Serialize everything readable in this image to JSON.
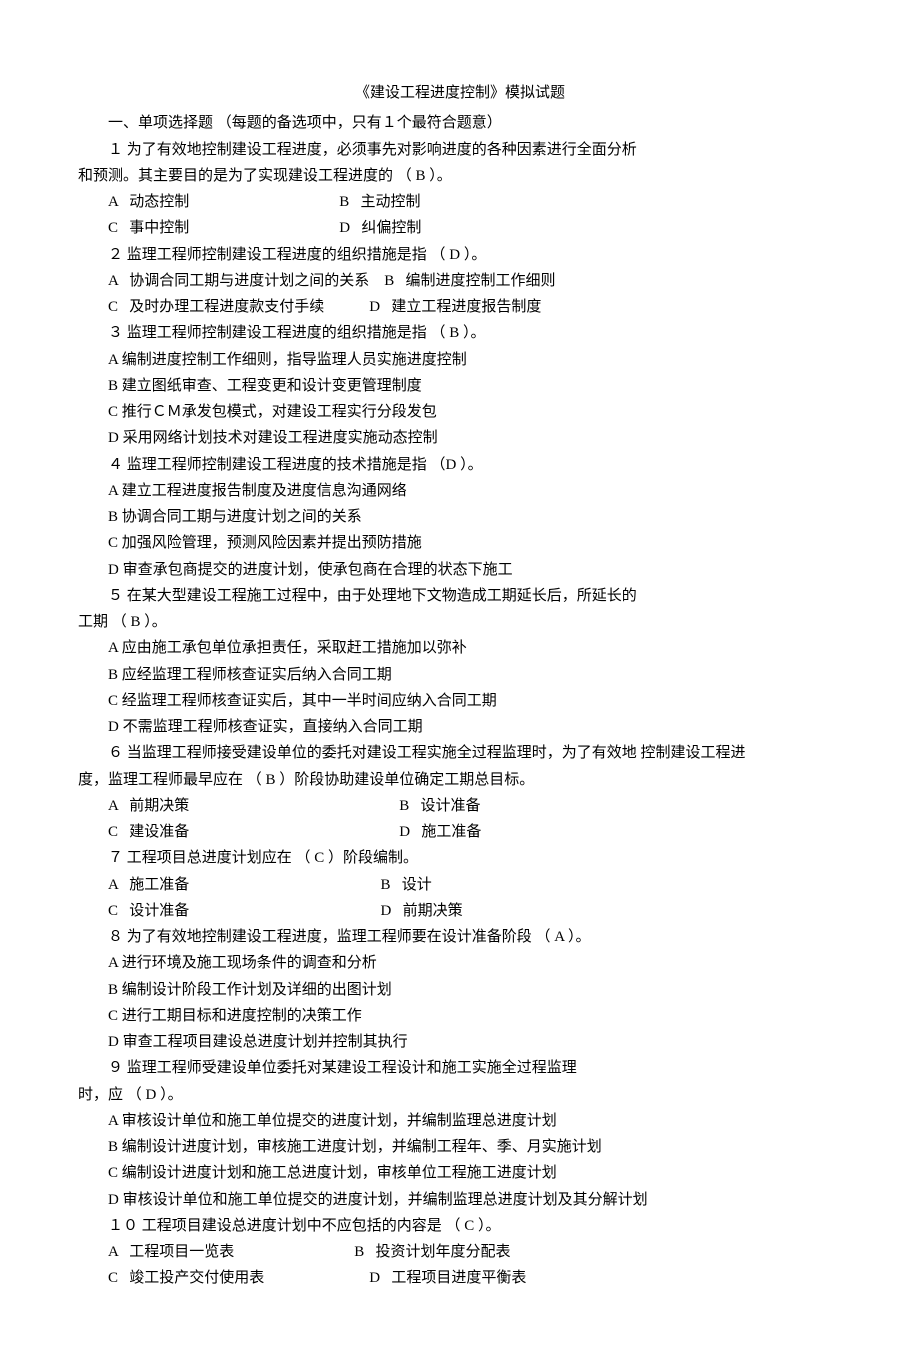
{
  "title": "《建设工程进度控制》模拟试题",
  "section1_heading": "一、单项选择题  （每题的备选项中，只有１个最符合题意）",
  "q1": {
    "stem": "１   为了有效地控制建设工程进度，必须事先对影响进度的各种因素进行全面分析",
    "cont": "和预测。其主要目的是为了实现建设工程进度的  （   B   ）。",
    "A": "动态控制",
    "B": "主动控制",
    "C": "事中控制",
    "D": "纠偏控制"
  },
  "q2": {
    "stem": "２   监理工程师控制建设工程进度的组织措施是指  （   D   ）。",
    "A": "协调合同工期与进度计划之间的关系",
    "B": "编制进度控制工作细则",
    "C": "及时办理工程进度款支付手续",
    "D": "建立工程进度报告制度"
  },
  "q3": {
    "stem": "３   监理工程师控制建设工程进度的组织措施是指  （   B    ）。",
    "A": "编制进度控制工作细则，指导监理人员实施进度控制",
    "B": "建立图纸审查、工程变更和设计变更管理制度",
    "C": "推行ＣＭ承发包模式，对建设工程实行分段发包",
    "D": "采用网络计划技术对建设工程进度实施动态控制"
  },
  "q4": {
    "stem": "４   监理工程师控制建设工程进度的技术措施是指  （D       ）。",
    "A": "建立工程进度报告制度及进度信息沟通网络",
    "B": "协调合同工期与进度计划之间的关系",
    "C": "加强风险管理，预测风险因素并提出预防措施",
    "D": "审查承包商提交的进度计划，使承包商在合理的状态下施工"
  },
  "q5": {
    "stem": "５   在某大型建设工程施工过程中，由于处理地下文物造成工期延长后，所延长的",
    "cont": "工期  （  B   ）。",
    "A": "应由施工承包单位承担责任，采取赶工措施加以弥补",
    "B": "应经监理工程师核查证实后纳入合同工期",
    "C": "经监理工程师核查证实后，其中一半时间应纳入合同工期",
    "D": "不需监理工程师核查证实，直接纳入合同工期"
  },
  "q6": {
    "stem": "６   当监理工程师接受建设单位的委托对建设工程实施全过程监理时，为了有效地  控制建设工程进",
    "cont": "度，监理工程师最早应在  （  B   ）阶段协助建设单位确定工期总目标。",
    "A": "前期决策",
    "B": "设计准备",
    "C": "建设准备",
    "D": "施工准备"
  },
  "q7": {
    "stem": "７   工程项目总进度计划应在  （   C   ）阶段编制。",
    "A": "施工准备",
    "B": "设计",
    "C": "设计准备",
    "D": "前期决策"
  },
  "q8": {
    "stem": "８   为了有效地控制建设工程进度，监理工程师要在设计准备阶段  （   A   ）。",
    "A": "进行环境及施工现场条件的调查和分析",
    "B": "编制设计阶段工作计划及详细的出图计划",
    "C": "进行工期目标和进度控制的决策工作",
    "D": "审查工程项目建设总进度计划并控制其执行"
  },
  "q9": {
    "stem": "９   监理工程师受建设单位委托对某建设工程设计和施工实施全过程监理",
    "cont": "时，应  （  D   ）。",
    "A": "审核设计单位和施工单位提交的进度计划，并编制监理总进度计划",
    "B": "编制设计进度计划，审核施工进度计划，并编制工程年、季、月实施计划",
    "C": "编制设计进度计划和施工总进度计划，审核单位工程施工进度计划",
    "D": "审核设计单位和施工单位提交的进度计划，并编制监理总进度计划及其分解计划"
  },
  "q10": {
    "stem": "１０   工程项目建设总进度计划中不应包括的内容是  （   C   ）。",
    "A": "工程项目一览表",
    "B": "投资计划年度分配表",
    "C": "竣工投产交付使用表",
    "D": "工程项目进度平衡表"
  }
}
